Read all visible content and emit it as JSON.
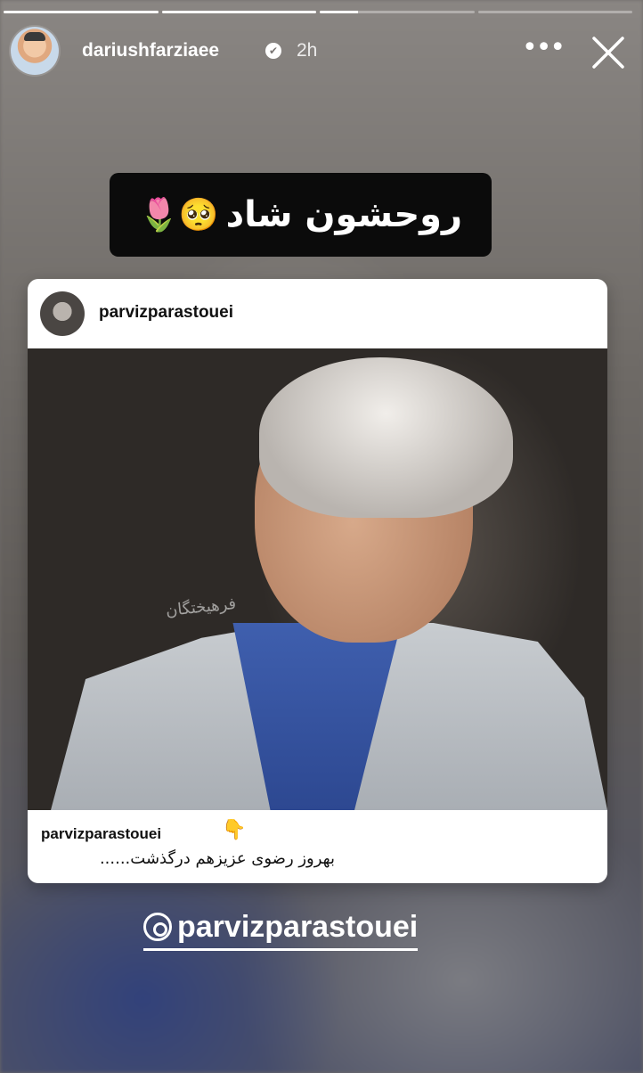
{
  "story": {
    "progress_segments": [
      1,
      1,
      0.25,
      0
    ],
    "user": {
      "username": "dariushfarziaee",
      "time": "2h",
      "verified_mark": "✔"
    },
    "controls": {
      "more_label": "•••"
    },
    "caption": {
      "text": "روحشون شاد",
      "emoji": "🥺🌷"
    },
    "post": {
      "author": "parvizparastouei",
      "footer_user": "parvizparastouei",
      "footer_emoji": "👇",
      "caption": "بهروز رضوی عزیزهم درگذشت......",
      "watermark": "فرهیختگان"
    },
    "mention": {
      "text": "parvizparastouei"
    }
  }
}
